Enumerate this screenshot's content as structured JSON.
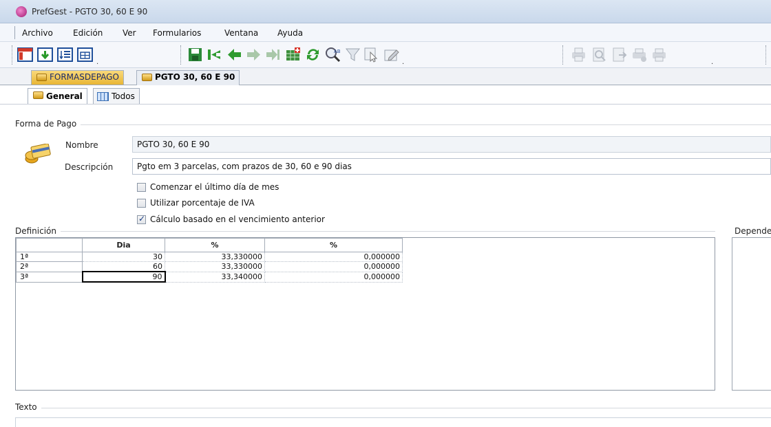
{
  "window": {
    "title": "PrefGest - PGTO 30, 60 E 90",
    "app_icon": "prefgest-logo-icon"
  },
  "menu": [
    "Archivo",
    "Edición",
    "Ver",
    "Formularios",
    "Ventana",
    "Ayuda"
  ],
  "toolbar": {
    "icons": [
      "window-icon",
      "download-icon",
      "sort-list-icon",
      "table-view-icon",
      "save-icon",
      "first-record-icon",
      "previous-record-icon",
      "next-record-icon",
      "last-record-icon",
      "add-record-icon",
      "refresh-icon",
      "search-icon",
      "filter-icon",
      "select-icon",
      "edit-icon",
      "print-icon",
      "print-preview-icon",
      "export-icon",
      "print-setup-icon",
      "print-options-icon"
    ]
  },
  "doc_tabs": [
    {
      "label": "FORMASDEPAGO",
      "active": false
    },
    {
      "label": "PGTO 30, 60 E 90",
      "active": true
    }
  ],
  "sub_tabs": [
    {
      "label": "General",
      "active": true
    },
    {
      "label": "Todos",
      "active": false
    }
  ],
  "forma_de_pago": {
    "section_label": "Forma de Pago",
    "nombre_label": "Nombre",
    "nombre_value": "PGTO 30, 60 E 90",
    "descripcion_label": "Descripción",
    "descripcion_value": "Pgto em 3 parcelas, com prazos de 30, 60 e 90 dias",
    "checkboxes": [
      {
        "label": "Comenzar el último día de mes",
        "checked": false
      },
      {
        "label": "Utilizar porcentaje de IVA",
        "checked": false
      },
      {
        "label": "Cálculo basado en el vencimiento anterior",
        "checked": true
      }
    ]
  },
  "definicion": {
    "section_label": "Definición",
    "columns": [
      "",
      "Dia",
      "%",
      "%"
    ],
    "rows": [
      {
        "row": "1ª",
        "dia": "30",
        "pct1": "33,330000",
        "pct2": "0,000000"
      },
      {
        "row": "2ª",
        "dia": "60",
        "pct1": "33,330000",
        "pct2": "0,000000"
      },
      {
        "row": "3ª",
        "dia": "90",
        "pct1": "33,340000",
        "pct2": "0,000000"
      }
    ],
    "selected_row": 2
  },
  "dependencias_label": "Depende",
  "texto_label": "Texto"
}
